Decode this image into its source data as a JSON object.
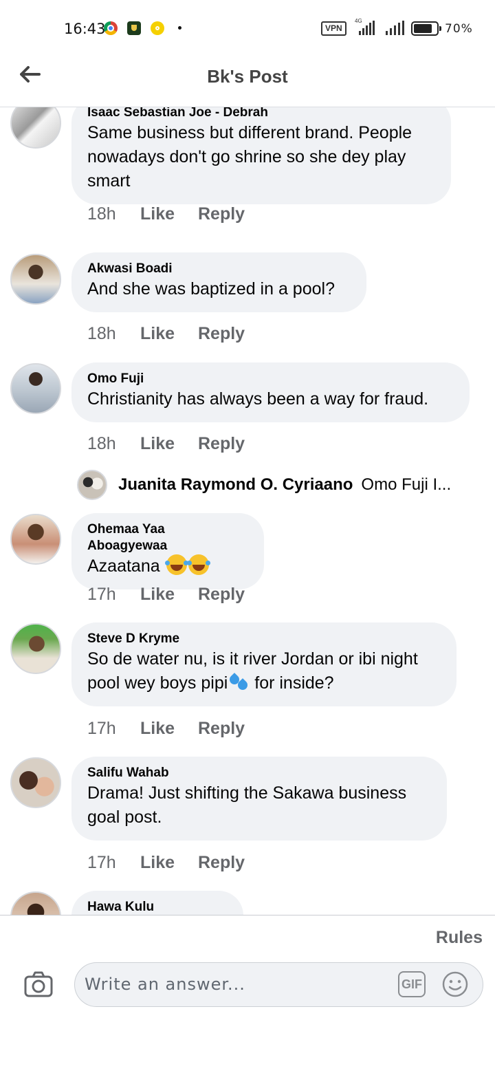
{
  "status_bar": {
    "time": "16:43",
    "vpn": "VPN",
    "network": "4G",
    "battery": "70%",
    "icons": [
      "chrome-icon",
      "shield-app-icon",
      "yellow-app-icon",
      "signal-icon",
      "battery-icon"
    ]
  },
  "header": {
    "title": "Bk's Post",
    "back_icon": "arrow-left-icon"
  },
  "comments": [
    {
      "author": "Isaac Sebastian Joe - Debrah",
      "text": "Same business but different brand. People\nnowadays don't go shrine so she dey play\nsmart",
      "time": "18h",
      "like": "Like",
      "reply": "Reply"
    },
    {
      "author": "Akwasi Boadi",
      "text": "And she was baptized in a pool?",
      "time": "18h",
      "like": "Like",
      "reply": "Reply"
    },
    {
      "author": "Omo Fuji",
      "text": "Christianity has always been a way for fraud.",
      "time": "18h",
      "like": "Like",
      "reply": "Reply"
    },
    {
      "author": "Ohemaa Yaa Aboagyewaa",
      "text": "Azaatana ",
      "time": "17h",
      "like": "Like",
      "reply": "Reply"
    },
    {
      "author": "Steve D Kryme",
      "text_line1": "So de water nu, is it river Jordan or ibi night",
      "text_line2a": "pool wey boys pipi",
      "text_line2b": " for inside?",
      "time": "17h",
      "like": "Like",
      "reply": "Reply"
    },
    {
      "author": "Salifu Wahab",
      "text": "Drama! Just shifting the Sakawa business\ngoal post.",
      "time": "17h",
      "like": "Like",
      "reply": "Reply"
    },
    {
      "author": "Hawa Kulu"
    }
  ],
  "reply_preview": {
    "author": "Juanita Raymond O. Cyriaano",
    "text": "Omo Fuji I..."
  },
  "composer": {
    "rules": "Rules",
    "placeholder": "Write an answer...",
    "gif": "GIF",
    "camera_icon": "camera-icon",
    "emoji_icon": "smiley-icon"
  },
  "colors": {
    "bubble": "#f0f2f5",
    "meta_text": "#65676b",
    "divider": "#dadde1"
  }
}
